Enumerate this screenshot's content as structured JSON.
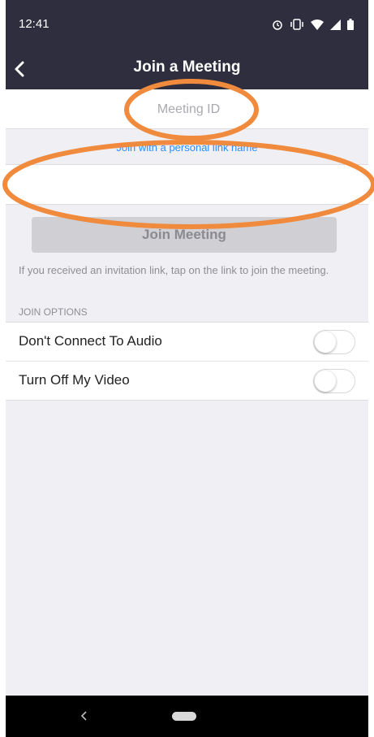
{
  "status_bar": {
    "time": "12:41",
    "icons": [
      "alarm-icon",
      "vibrate-icon",
      "wifi-icon",
      "signal-icon",
      "battery-icon"
    ]
  },
  "header": {
    "title": "Join a Meeting",
    "back_icon": "chevron-left-icon"
  },
  "meeting_id": {
    "placeholder": "Meeting ID",
    "value": ""
  },
  "personal_link_text": "Join with a personal link name",
  "name_field": {
    "value": ""
  },
  "join_button": {
    "label": "Join Meeting",
    "enabled": false
  },
  "hint_text": "If you received an invitation link, tap on the link to join the meeting.",
  "options": {
    "header": "JOIN OPTIONS",
    "items": [
      {
        "label": "Don't Connect To Audio",
        "on": false
      },
      {
        "label": "Turn Off My Video",
        "on": false
      }
    ]
  },
  "colors": {
    "header_bg": "#2e2e3e",
    "link": "#2d8cff",
    "annotation": "#f08a3c",
    "disabled_button": "#cfcfd4"
  },
  "system_nav": {
    "icons": [
      "back-triangle-icon",
      "home-pill-icon"
    ]
  }
}
